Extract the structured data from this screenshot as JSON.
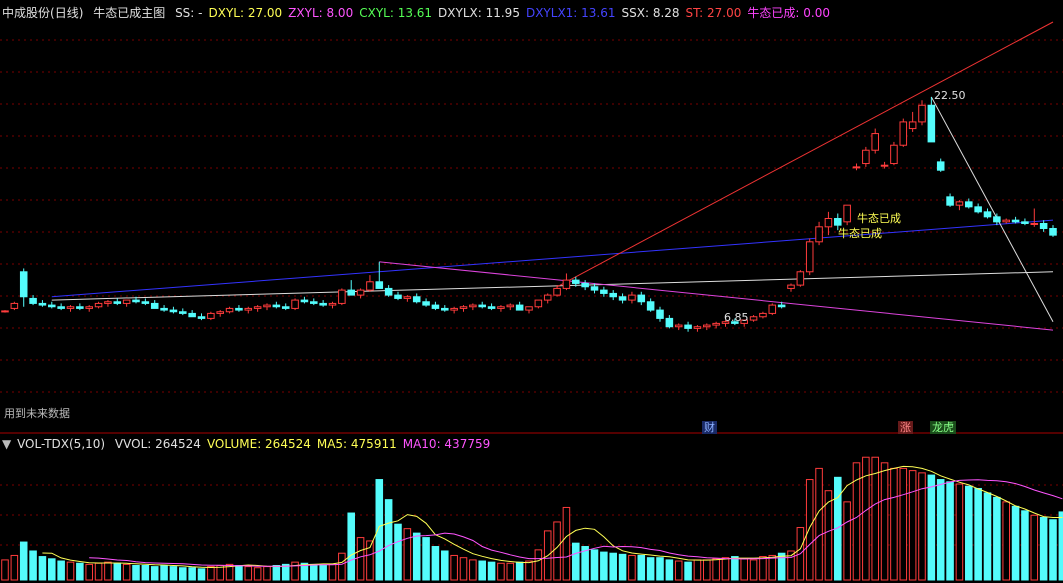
{
  "main_panel": {
    "stock_name": "中成股份",
    "period": "(日线)",
    "indicator_name": "牛态已成主图",
    "values": [
      {
        "label": "SS: -",
        "color": "#e0e0e0"
      },
      {
        "label": "DXYL: 27.00",
        "color": "#ffff55"
      },
      {
        "label": "ZXYL: 8.00",
        "color": "#ff55ff"
      },
      {
        "label": "CXYL: 13.61",
        "color": "#55ff55"
      },
      {
        "label": "DXYLX: 11.95",
        "color": "#e0e0e0"
      },
      {
        "label": "DXYLX1: 13.61",
        "color": "#4444ff"
      },
      {
        "label": "SSX: 8.28",
        "color": "#e0e0e0"
      },
      {
        "label": "ST: 27.00",
        "color": "#ff4444"
      },
      {
        "label": "牛态已成: 0.00",
        "color": "#ff44ff"
      }
    ],
    "high_label": "22.50",
    "low_label": "6.85",
    "signal_labels": [
      "牛态已成",
      "牛态已成"
    ],
    "future_data_note": "用到未来数据"
  },
  "event_tags": [
    {
      "text": "财",
      "color": "#4488ff"
    },
    {
      "text": "涨",
      "color": "#ff5555"
    },
    {
      "text": "龙虎",
      "color": "#44dd44"
    }
  ],
  "volume_panel": {
    "indicator": "VOL-TDX(5,10)",
    "values": [
      {
        "label": "VVOL: 264524",
        "color": "#e0e0e0"
      },
      {
        "label": "VOLUME: 264524",
        "color": "#ffff55"
      },
      {
        "label": "MA5: 475911",
        "color": "#ffff55"
      },
      {
        "label": "MA10: 437759",
        "color": "#ff55ff"
      }
    ]
  },
  "colors": {
    "up": "#ff3c3c",
    "down": "#54fcfc",
    "grid": "#7a0000",
    "ma5": "#ffff55",
    "ma10": "#ff55ff"
  },
  "chart_data": {
    "type": "candlestick",
    "title": "中成股份(日线)",
    "price_range": [
      4.0,
      27.0
    ],
    "candles": [
      [
        9.6,
        9.7,
        9.55,
        9.65
      ],
      [
        9.8,
        10.2,
        9.7,
        10.1
      ],
      [
        12.0,
        12.2,
        9.9,
        10.5
      ],
      [
        10.4,
        10.6,
        10.0,
        10.1
      ],
      [
        10.1,
        10.3,
        9.9,
        10.0
      ],
      [
        10.0,
        10.2,
        9.8,
        9.9
      ],
      [
        9.9,
        10.1,
        9.7,
        9.8
      ],
      [
        9.8,
        10.0,
        9.6,
        9.9
      ],
      [
        9.9,
        10.1,
        9.7,
        9.8
      ],
      [
        9.8,
        10.0,
        9.6,
        9.9
      ],
      [
        9.9,
        10.2,
        9.8,
        10.1
      ],
      [
        10.1,
        10.3,
        9.9,
        10.2
      ],
      [
        10.2,
        10.4,
        10.0,
        10.1
      ],
      [
        10.1,
        10.3,
        9.9,
        10.3
      ],
      [
        10.3,
        10.5,
        10.1,
        10.2
      ],
      [
        10.2,
        10.4,
        10.0,
        10.1
      ],
      [
        10.1,
        10.3,
        9.9,
        9.8
      ],
      [
        9.8,
        10.0,
        9.6,
        9.7
      ],
      [
        9.7,
        9.9,
        9.5,
        9.6
      ],
      [
        9.6,
        9.8,
        9.4,
        9.5
      ],
      [
        9.5,
        9.7,
        9.3,
        9.3
      ],
      [
        9.3,
        9.5,
        9.1,
        9.2
      ],
      [
        9.2,
        9.6,
        9.1,
        9.5
      ],
      [
        9.5,
        9.7,
        9.3,
        9.6
      ],
      [
        9.6,
        9.9,
        9.5,
        9.8
      ],
      [
        9.8,
        10.0,
        9.6,
        9.7
      ],
      [
        9.7,
        9.9,
        9.5,
        9.8
      ],
      [
        9.8,
        10.0,
        9.6,
        9.9
      ],
      [
        9.9,
        10.1,
        9.7,
        10.0
      ],
      [
        10.0,
        10.2,
        9.8,
        9.9
      ],
      [
        9.9,
        10.1,
        9.7,
        9.8
      ],
      [
        9.8,
        10.4,
        9.7,
        10.3
      ],
      [
        10.3,
        10.5,
        10.1,
        10.2
      ],
      [
        10.2,
        10.4,
        10.0,
        10.1
      ],
      [
        10.1,
        10.3,
        9.9,
        10.0
      ],
      [
        10.0,
        10.2,
        9.8,
        10.1
      ],
      [
        10.1,
        11.0,
        10.0,
        10.9
      ],
      [
        10.9,
        11.5,
        10.8,
        10.6
      ],
      [
        10.6,
        11.0,
        10.4,
        10.9
      ],
      [
        10.9,
        11.8,
        10.8,
        11.4
      ],
      [
        11.4,
        12.6,
        11.3,
        11.0
      ],
      [
        11.0,
        11.2,
        10.5,
        10.6
      ],
      [
        10.6,
        10.8,
        10.3,
        10.4
      ],
      [
        10.4,
        10.6,
        10.2,
        10.5
      ],
      [
        10.5,
        10.7,
        10.1,
        10.2
      ],
      [
        10.2,
        10.4,
        9.9,
        10.0
      ],
      [
        10.0,
        10.2,
        9.7,
        9.8
      ],
      [
        9.8,
        10.0,
        9.6,
        9.7
      ],
      [
        9.7,
        9.9,
        9.5,
        9.8
      ],
      [
        9.8,
        10.0,
        9.6,
        9.9
      ],
      [
        9.9,
        10.1,
        9.7,
        10.0
      ],
      [
        10.0,
        10.2,
        9.8,
        9.9
      ],
      [
        9.9,
        10.1,
        9.7,
        9.8
      ],
      [
        9.8,
        10.0,
        9.6,
        9.9
      ],
      [
        9.9,
        10.1,
        9.7,
        10.0
      ],
      [
        10.0,
        10.2,
        9.8,
        9.7
      ],
      [
        9.7,
        9.9,
        9.5,
        9.9
      ],
      [
        9.9,
        10.3,
        9.8,
        10.3
      ],
      [
        10.3,
        10.7,
        10.1,
        10.6
      ],
      [
        10.6,
        11.2,
        10.5,
        11.0
      ],
      [
        11.0,
        11.9,
        10.9,
        11.5
      ],
      [
        11.5,
        11.7,
        11.1,
        11.3
      ],
      [
        11.3,
        11.5,
        10.9,
        11.1
      ],
      [
        11.1,
        11.3,
        10.7,
        10.9
      ],
      [
        10.9,
        11.1,
        10.5,
        10.7
      ],
      [
        10.7,
        10.9,
        10.3,
        10.5
      ],
      [
        10.5,
        10.7,
        10.1,
        10.3
      ],
      [
        10.3,
        10.8,
        10.1,
        10.6
      ],
      [
        10.6,
        10.8,
        10.0,
        10.2
      ],
      [
        10.2,
        10.4,
        9.6,
        9.7
      ],
      [
        9.7,
        9.9,
        9.0,
        9.2
      ],
      [
        9.2,
        9.4,
        8.6,
        8.7
      ],
      [
        8.7,
        8.9,
        8.5,
        8.8
      ],
      [
        8.8,
        9.0,
        8.4,
        8.6
      ],
      [
        8.6,
        8.8,
        8.4,
        8.7
      ],
      [
        8.7,
        8.9,
        8.5,
        8.8
      ],
      [
        8.8,
        9.0,
        8.6,
        8.9
      ],
      [
        8.9,
        9.1,
        8.7,
        9.0
      ],
      [
        9.0,
        9.2,
        8.8,
        8.9
      ],
      [
        8.9,
        9.1,
        8.7,
        9.1
      ],
      [
        9.1,
        9.4,
        9.0,
        9.3
      ],
      [
        9.3,
        9.6,
        9.2,
        9.5
      ],
      [
        9.5,
        10.1,
        9.4,
        10.0
      ],
      [
        10.0,
        10.2,
        9.8,
        9.9
      ],
      [
        11.0,
        11.3,
        10.8,
        11.2
      ],
      [
        11.2,
        12.1,
        11.1,
        12.0
      ],
      [
        12.0,
        14.0,
        11.8,
        13.8
      ],
      [
        13.8,
        15.0,
        13.6,
        14.7
      ],
      [
        14.7,
        15.6,
        14.2,
        15.2
      ],
      [
        15.2,
        15.5,
        14.5,
        14.8
      ],
      [
        15.0,
        16.0,
        14.8,
        16.0
      ],
      [
        18.3,
        18.5,
        18.1,
        18.3
      ],
      [
        18.5,
        19.5,
        18.3,
        19.3
      ],
      [
        19.3,
        20.6,
        19.1,
        20.3
      ],
      [
        18.4,
        18.6,
        18.2,
        18.4
      ],
      [
        18.5,
        19.8,
        18.4,
        19.6
      ],
      [
        19.6,
        21.2,
        19.5,
        21.0
      ],
      [
        20.6,
        21.6,
        20.4,
        21.0
      ],
      [
        21.0,
        22.3,
        20.8,
        22.0
      ],
      [
        22.0,
        22.5,
        21.2,
        19.8
      ],
      [
        18.6,
        18.8,
        18.0,
        18.1
      ],
      [
        16.5,
        16.7,
        15.9,
        16.0
      ],
      [
        16.0,
        16.3,
        15.7,
        16.2
      ],
      [
        16.2,
        16.4,
        15.8,
        15.9
      ],
      [
        15.9,
        16.1,
        15.5,
        15.6
      ],
      [
        15.6,
        15.8,
        15.2,
        15.3
      ],
      [
        15.3,
        15.5,
        14.8,
        15.0
      ],
      [
        15.0,
        15.2,
        14.9,
        15.1
      ],
      [
        15.1,
        15.3,
        14.9,
        15.0
      ],
      [
        15.0,
        15.2,
        14.8,
        14.9
      ],
      [
        14.9,
        15.8,
        14.7,
        14.9
      ],
      [
        14.9,
        15.1,
        14.4,
        14.6
      ],
      [
        14.6,
        14.8,
        14.1,
        14.2
      ]
    ],
    "volume": [
      180,
      220,
      340,
      260,
      210,
      190,
      170,
      160,
      150,
      140,
      150,
      160,
      150,
      140,
      130,
      130,
      120,
      130,
      120,
      110,
      110,
      100,
      120,
      130,
      140,
      130,
      120,
      110,
      120,
      130,
      140,
      160,
      150,
      140,
      130,
      140,
      240,
      600,
      380,
      350,
      900,
      720,
      500,
      460,
      420,
      380,
      300,
      260,
      220,
      200,
      180,
      170,
      160,
      150,
      150,
      160,
      170,
      270,
      440,
      520,
      650,
      330,
      300,
      270,
      250,
      240,
      230,
      220,
      220,
      200,
      200,
      180,
      170,
      160,
      180,
      180,
      190,
      200,
      210,
      190,
      180,
      210,
      220,
      240,
      260,
      470,
      900,
      1000,
      800,
      920,
      700,
      1050,
      1100,
      1100,
      1050,
      1000,
      1000,
      980,
      960,
      940,
      900,
      880,
      860,
      840,
      820,
      780,
      740,
      700,
      660,
      620,
      580,
      560,
      540,
      610
    ],
    "ma5": [
      null,
      null,
      null,
      null,
      242,
      240,
      198,
      178,
      166,
      154,
      152,
      152,
      152,
      150,
      146,
      142,
      136,
      134,
      130,
      126,
      118,
      114,
      112,
      114,
      120,
      128,
      134,
      130,
      124,
      122,
      124,
      130,
      136,
      140,
      144,
      144,
      158,
      224,
      264,
      290,
      480,
      510,
      530,
      586,
      570,
      508,
      406,
      368,
      320,
      276,
      236,
      212,
      192,
      176,
      166,
      158,
      156,
      172,
      218,
      292,
      390,
      444,
      464,
      454,
      386,
      306,
      262,
      242,
      232,
      224,
      214,
      208,
      194,
      180,
      178,
      178,
      182,
      188,
      196,
      196,
      196,
      198,
      204,
      212,
      218,
      280,
      470,
      618,
      698,
      738,
      846,
      896,
      934,
      954,
      980,
      1000,
      1018,
      1014,
      1000,
      974,
      934,
      904,
      876,
      852,
      816,
      784,
      748,
      708,
      664,
      636,
      600,
      568,
      560,
      560
    ],
    "ma10": [
      null,
      null,
      null,
      null,
      null,
      null,
      null,
      null,
      null,
      199,
      196,
      188,
      179,
      175,
      164,
      156,
      152,
      150,
      148,
      146,
      140,
      134,
      132,
      132,
      130,
      128,
      126,
      124,
      124,
      124,
      124,
      126,
      130,
      134,
      136,
      136,
      142,
      178,
      208,
      226,
      260,
      308,
      344,
      374,
      394,
      398,
      404,
      420,
      412,
      386,
      354,
      300,
      268,
      248,
      226,
      206,
      192,
      192,
      194,
      202,
      206,
      238,
      262,
      284,
      302,
      296,
      300,
      298,
      290,
      274,
      264,
      242,
      226,
      214,
      208,
      200,
      196,
      192,
      190,
      188,
      190,
      192,
      196,
      200,
      202,
      236,
      318,
      398,
      436,
      468,
      520,
      560,
      624,
      680,
      720,
      740,
      764,
      790,
      818,
      834,
      856,
      878,
      892,
      896,
      898,
      892,
      890,
      880,
      864,
      838,
      806,
      780,
      756,
      728
    ]
  }
}
